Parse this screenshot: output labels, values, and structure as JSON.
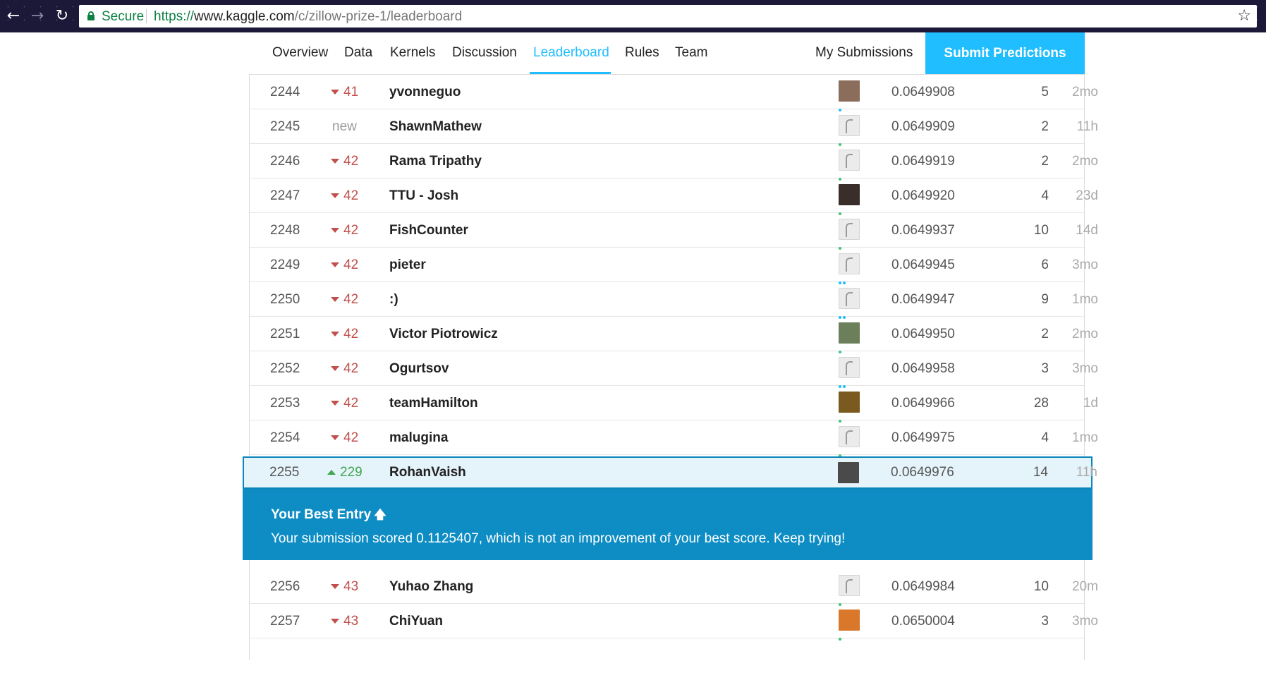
{
  "browser": {
    "secure_label": "Secure",
    "url_scheme": "https://",
    "url_host": "www.kaggle.com",
    "url_path": "/c/zillow-prize-1/leaderboard",
    "icons": [
      "back-icon",
      "forward-icon",
      "reload-icon",
      "lock-icon",
      "star-icon"
    ]
  },
  "tabs": {
    "overview": "Overview",
    "data": "Data",
    "kernels": "Kernels",
    "discussion": "Discussion",
    "leaderboard": "Leaderboard",
    "rules": "Rules",
    "team": "Team",
    "my_submissions": "My Submissions",
    "submit": "Submit Predictions",
    "active": "Leaderboard"
  },
  "colors": {
    "accent": "#20beff",
    "up": "#3fa750",
    "down": "#c0504d",
    "banner": "#0d8dc4",
    "highlight_row": "#e5f3fa"
  },
  "rows": [
    {
      "rank": "2244",
      "dir": "down",
      "change": "41",
      "team": "yvonneguo",
      "avatar": "photo",
      "avatar_color": "#8a6d5a",
      "dots": [
        "#20beff"
      ],
      "score": "0.0649908",
      "entries": "5",
      "last": "2mo"
    },
    {
      "rank": "2245",
      "dir": "new",
      "change": "new",
      "team": "ShawnMathew",
      "avatar": "goose",
      "dots": [
        "#3fc27a"
      ],
      "score": "0.0649909",
      "entries": "2",
      "last": "11h"
    },
    {
      "rank": "2246",
      "dir": "down",
      "change": "42",
      "team": "Rama Tripathy",
      "avatar": "goose",
      "dots": [
        "#3fc27a"
      ],
      "score": "0.0649919",
      "entries": "2",
      "last": "2mo"
    },
    {
      "rank": "2247",
      "dir": "down",
      "change": "42",
      "team": "TTU - Josh",
      "avatar": "photo",
      "avatar_color": "#3a2e2a",
      "dots": [
        "#3fc27a"
      ],
      "score": "0.0649920",
      "entries": "4",
      "last": "23d"
    },
    {
      "rank": "2248",
      "dir": "down",
      "change": "42",
      "team": "FishCounter",
      "avatar": "goose",
      "dots": [
        "#3fc27a"
      ],
      "score": "0.0649937",
      "entries": "10",
      "last": "14d"
    },
    {
      "rank": "2249",
      "dir": "down",
      "change": "42",
      "team": "pieter",
      "avatar": "goose",
      "dots": [
        "#20beff",
        "#20beff"
      ],
      "score": "0.0649945",
      "entries": "6",
      "last": "3mo"
    },
    {
      "rank": "2250",
      "dir": "down",
      "change": "42",
      "team": ":)",
      "avatar": "goose",
      "dots": [
        "#20beff",
        "#20beff"
      ],
      "score": "0.0649947",
      "entries": "9",
      "last": "1mo"
    },
    {
      "rank": "2251",
      "dir": "down",
      "change": "42",
      "team": "Victor Piotrowicz",
      "avatar": "photo",
      "avatar_color": "#6b7f5a",
      "dots": [
        "#3fc27a"
      ],
      "score": "0.0649950",
      "entries": "2",
      "last": "2mo"
    },
    {
      "rank": "2252",
      "dir": "down",
      "change": "42",
      "team": "Ogurtsov",
      "avatar": "goose",
      "dots": [
        "#20beff",
        "#20beff"
      ],
      "score": "0.0649958",
      "entries": "3",
      "last": "3mo"
    },
    {
      "rank": "2253",
      "dir": "down",
      "change": "42",
      "team": "teamHamilton",
      "avatar": "photo",
      "avatar_color": "#7a5a1e",
      "dots": [
        "#3fc27a"
      ],
      "score": "0.0649966",
      "entries": "28",
      "last": "1d"
    },
    {
      "rank": "2254",
      "dir": "down",
      "change": "42",
      "team": "malugina",
      "avatar": "goose",
      "dots": [
        "#3fc27a"
      ],
      "score": "0.0649975",
      "entries": "4",
      "last": "1mo"
    }
  ],
  "my_row": {
    "rank": "2255",
    "dir": "up",
    "change": "229",
    "team": "RohanVaish",
    "avatar": "photo",
    "avatar_color": "#4a4a4a",
    "dots": [
      "#3fc27a"
    ],
    "score": "0.0649976",
    "entries": "14",
    "last": "11h"
  },
  "banner": {
    "title": "Your Best Entry",
    "message": "Your submission scored 0.1125407, which is not an improvement of your best score. Keep trying!"
  },
  "rows_after": [
    {
      "rank": "2256",
      "dir": "down",
      "change": "43",
      "team": "Yuhao Zhang",
      "avatar": "goose",
      "dots": [
        "#3fc27a"
      ],
      "score": "0.0649984",
      "entries": "10",
      "last": "20m"
    },
    {
      "rank": "2257",
      "dir": "down",
      "change": "43",
      "team": "ChiYuan",
      "avatar": "photo",
      "avatar_color": "#d9782a",
      "dots": [
        "#3fc27a"
      ],
      "score": "0.0650004",
      "entries": "3",
      "last": "3mo"
    }
  ]
}
